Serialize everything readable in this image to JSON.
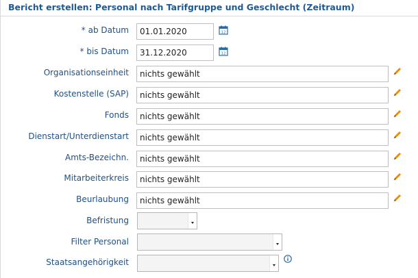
{
  "title": "Bericht erstellen: Personal nach Tarifgruppe und Geschlecht (Zeitraum)",
  "fields": {
    "ab_datum": {
      "label": "* ab Datum",
      "value": "01.01.2020",
      "icon": "calendar-icon"
    },
    "bis_datum": {
      "label": "* bis Datum",
      "value": "31.12.2020",
      "icon": "calendar-icon"
    },
    "organisationseinheit": {
      "label": "Organisationseinheit",
      "value": "nichts gewählt",
      "icon": "pencil-icon"
    },
    "kostenstelle": {
      "label": "Kostenstelle (SAP)",
      "value": "nichts gewählt",
      "icon": "pencil-icon"
    },
    "fonds": {
      "label": "Fonds",
      "value": "nichts gewählt",
      "icon": "pencil-icon"
    },
    "dienstart": {
      "label": "Dienstart/Unterdienstart",
      "value": "nichts gewählt",
      "icon": "pencil-icon"
    },
    "amts_bezeichn": {
      "label": "Amts-Bezeichn.",
      "value": "nichts gewählt",
      "icon": "pencil-icon"
    },
    "mitarbeiterkreis": {
      "label": "Mitarbeiterkreis",
      "value": "nichts gewählt",
      "icon": "pencil-icon"
    },
    "beurlaubung": {
      "label": "Beurlaubung",
      "value": "nichts gewählt",
      "icon": "pencil-icon"
    },
    "befristung": {
      "label": "Befristung",
      "value": ""
    },
    "filter_personal": {
      "label": "Filter Personal",
      "value": ""
    },
    "staatsangehoerigkeit": {
      "label": "Staatsangehörigkeit",
      "value": "",
      "icon": "info-icon"
    }
  },
  "colors": {
    "label": "#1f4f86",
    "title": "#1f5a96",
    "pencil": "#f08a00",
    "calendar": "#2a6aa8",
    "info": "#2a6aa8"
  }
}
